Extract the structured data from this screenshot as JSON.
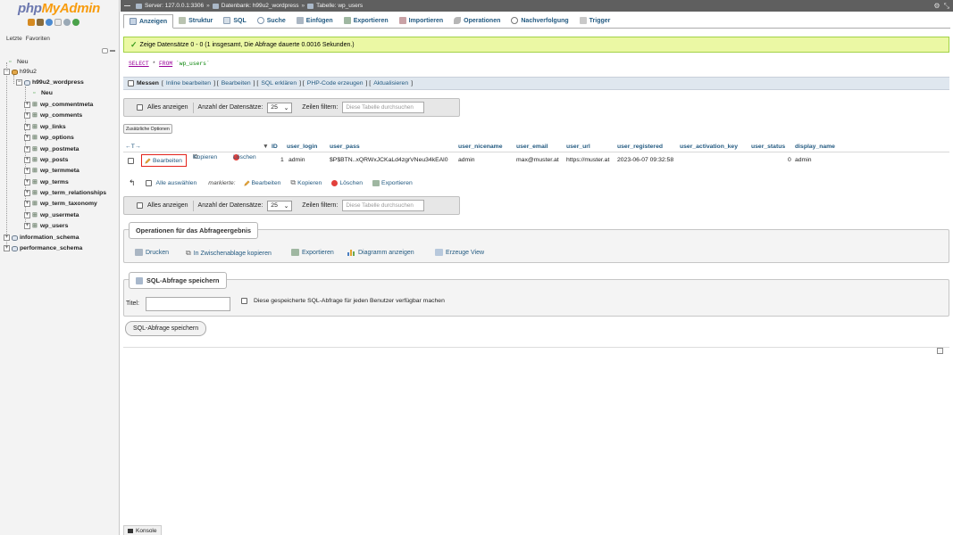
{
  "nav": {
    "logo": {
      "part1": "php",
      "part2": "MyAdmin"
    },
    "tabs": [
      "Letzte",
      "Favoriten"
    ],
    "tree": [
      {
        "label": "Neu",
        "depth": 0,
        "bold": false
      },
      {
        "label": "h99u2",
        "depth": 0,
        "bold": false
      },
      {
        "label": "h99u2_wordpress",
        "depth": 1,
        "bold": true
      },
      {
        "label": "Neu",
        "depth": 2,
        "bold": true
      },
      {
        "label": "wp_commentmeta",
        "depth": 2,
        "bold": true
      },
      {
        "label": "wp_comments",
        "depth": 2,
        "bold": true
      },
      {
        "label": "wp_links",
        "depth": 2,
        "bold": true
      },
      {
        "label": "wp_options",
        "depth": 2,
        "bold": true
      },
      {
        "label": "wp_postmeta",
        "depth": 2,
        "bold": true
      },
      {
        "label": "wp_posts",
        "depth": 2,
        "bold": true
      },
      {
        "label": "wp_termmeta",
        "depth": 2,
        "bold": true
      },
      {
        "label": "wp_terms",
        "depth": 2,
        "bold": true
      },
      {
        "label": "wp_term_relationships",
        "depth": 2,
        "bold": true
      },
      {
        "label": "wp_term_taxonomy",
        "depth": 2,
        "bold": true
      },
      {
        "label": "wp_usermeta",
        "depth": 2,
        "bold": true
      },
      {
        "label": "wp_users",
        "depth": 2,
        "bold": true
      },
      {
        "label": "information_schema",
        "depth": 0,
        "bold": true
      },
      {
        "label": "performance_schema",
        "depth": 0,
        "bold": true
      }
    ]
  },
  "breadcrumb": {
    "server": "Server: 127.0.0.1:3306",
    "database": "Datenbank: h99u2_wordpress",
    "table": "Tabelle: wp_users",
    "separator": "»"
  },
  "tabs": [
    {
      "label": "Anzeigen",
      "icon": "browse-icon",
      "active": true
    },
    {
      "label": "Struktur",
      "icon": "structure-icon",
      "active": false
    },
    {
      "label": "SQL",
      "icon": "sql-icon",
      "active": false
    },
    {
      "label": "Suche",
      "icon": "search-icon",
      "active": false
    },
    {
      "label": "Einfügen",
      "icon": "insert-icon",
      "active": false
    },
    {
      "label": "Exportieren",
      "icon": "export-icon",
      "active": false
    },
    {
      "label": "Importieren",
      "icon": "import-icon",
      "active": false
    },
    {
      "label": "Operationen",
      "icon": "wrench-icon",
      "active": false
    },
    {
      "label": "Nachverfolgung",
      "icon": "eye-icon",
      "active": false
    },
    {
      "label": "Trigger",
      "icon": "trigger-icon",
      "active": false
    }
  ],
  "success": "Zeige Datensätze 0 - 0 (1 insgesamt, Die Abfrage dauerte 0.0016 Sekunden.)",
  "query": {
    "kw1": "SELECT",
    "mid": " * ",
    "kw2": "FROM",
    "table": " `wp_users`"
  },
  "toolbar": {
    "measure": "Messen",
    "links": [
      "Inline bearbeiten",
      "Bearbeiten",
      "SQL erklären",
      "PHP-Code erzeugen",
      "Aktualisieren"
    ]
  },
  "navbox": {
    "show_all": "Alles anzeigen",
    "rows_label": "Anzahl der Datensätze:",
    "rows_value": "25",
    "filter_label": "Zeilen filtern:",
    "filter_placeholder": "Diese Tabelle durchsuchen"
  },
  "extra_options": "Zusätzliche Optionen",
  "results": {
    "nav_arrows": "←T→",
    "columns": [
      "ID",
      "user_login",
      "user_pass",
      "user_nicename",
      "user_email",
      "user_url",
      "user_registered",
      "user_activation_key",
      "user_status",
      "display_name"
    ],
    "row": {
      "edit": "Bearbeiten",
      "copy": "Kopieren",
      "delete": "Löschen",
      "cells": [
        "1",
        "admin",
        "$P$BTN..xQRWxJCKaLd4zgrVNeu34kEAl0",
        "admin",
        "max@muster.at",
        "https://muster.at",
        "2023-06-07 09:32:58",
        "",
        "0",
        "admin"
      ]
    }
  },
  "bulk": {
    "select_all": "Alle auswählen",
    "marked": "markierte:",
    "edit": "Bearbeiten",
    "copy": "Kopieren",
    "delete": "Löschen",
    "export": "Exportieren"
  },
  "operations": {
    "legend": "Operationen für das Abfrageergebnis",
    "items": [
      "Drucken",
      "In Zwischenablage kopieren",
      "Exportieren",
      "Diagramm anzeigen",
      "Erzeuge View"
    ]
  },
  "save_query": {
    "legend": "SQL-Abfrage speichern",
    "title_label": "Titel:",
    "title_value": "",
    "share_label": "Diese gespeicherte SQL-Abfrage für jeden Benutzer verfügbar machen",
    "button": "SQL-Abfrage speichern"
  },
  "console": "Konsole"
}
